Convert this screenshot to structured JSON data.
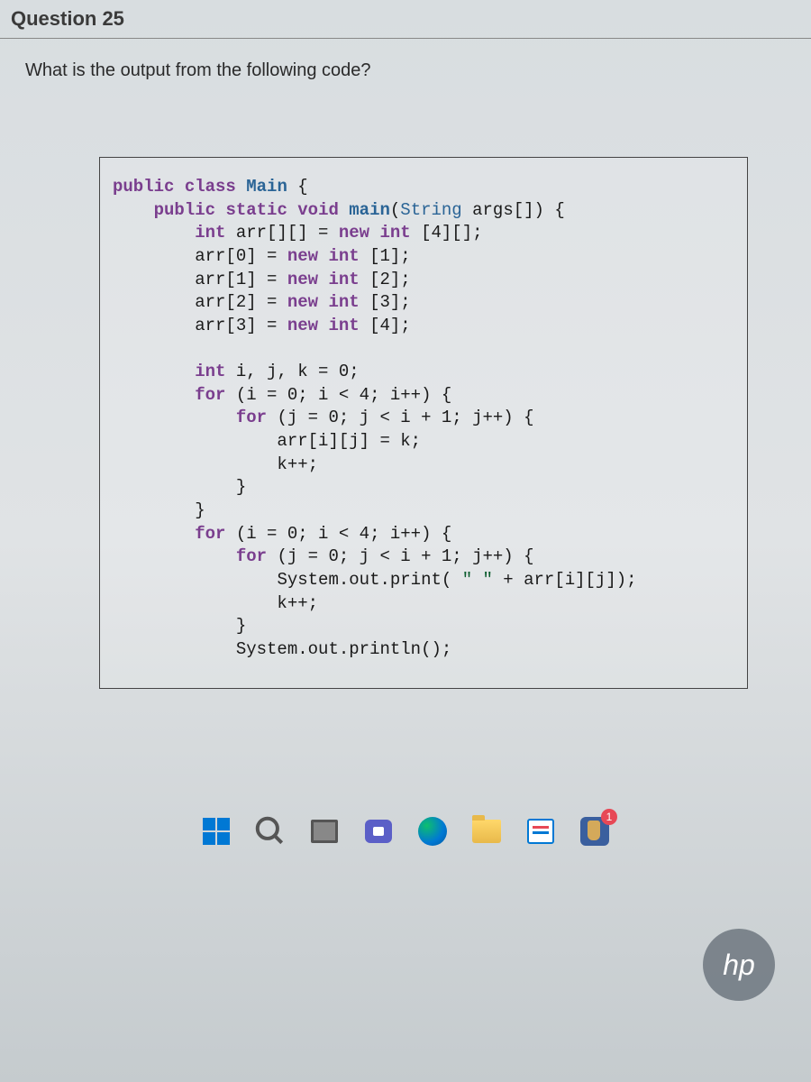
{
  "header": {
    "title": "Question 25"
  },
  "question": {
    "text": "What is the output from the following code?"
  },
  "code": {
    "lines": [
      "public class Main {",
      "    public static void main(String args[]) {",
      "        int arr[][] = new int [4][];",
      "        arr[0] = new int [1];",
      "        arr[1] = new int [2];",
      "        arr[2] = new int [3];",
      "        arr[3] = new int [4];",
      "",
      "        int i, j, k = 0;",
      "        for (i = 0; i < 4; i++) {",
      "            for (j = 0; j < i + 1; j++) {",
      "                arr[i][j] = k;",
      "                k++;",
      "            }",
      "        }",
      "        for (i = 0; i < 4; i++) {",
      "            for (j = 0; j < i + 1; j++) {",
      "                System.out.print( \" \" + arr[i][j]);",
      "                k++;",
      "            }",
      "            System.out.println();"
    ]
  },
  "taskbar": {
    "paint_badge": "1"
  },
  "branding": {
    "hp": "hp"
  }
}
